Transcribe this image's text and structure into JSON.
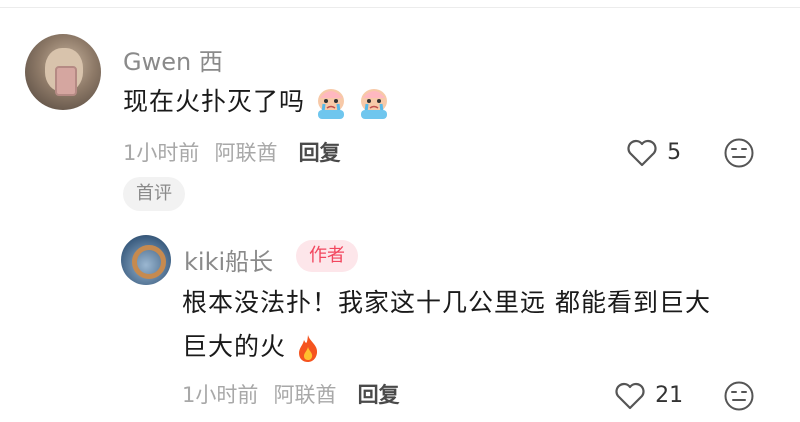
{
  "comment": {
    "username": "Gwen 西",
    "text": "现在火扑灭了吗",
    "emojis": [
      "crying-face-sticker",
      "crying-face-sticker"
    ],
    "time": "1小时前",
    "location": "阿联酋",
    "reply_label": "回复",
    "like_count": "5",
    "badge": "首评"
  },
  "reply": {
    "username": "kiki船长",
    "badge": "作者",
    "text_line1": "根本没法扑！我家这十几公里远 都能看到巨大",
    "text_line2": "巨大的火",
    "emoji": "fire",
    "time": "1小时前",
    "location": "阿联酋",
    "reply_label": "回复",
    "like_count": "21"
  },
  "colors": {
    "author_badge": "#f2465e",
    "text": "#1a1a1a",
    "meta": "#a8a8a8"
  }
}
